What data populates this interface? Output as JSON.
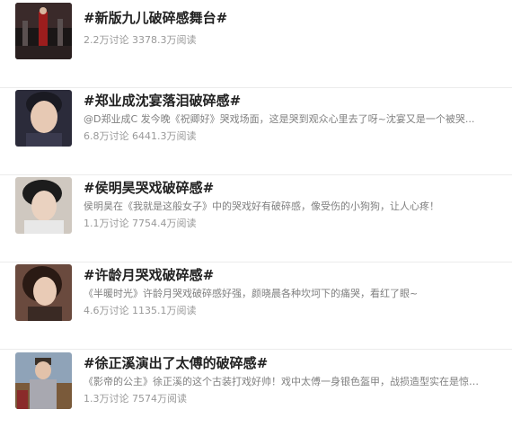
{
  "topics": [
    {
      "title": "#新版九儿破碎感舞台#",
      "description": "",
      "stats": "2.2万讨论 3378.3万阅读",
      "thumbnail_icon": "stage-performance-image"
    },
    {
      "title": "#郑业成沈宴落泪破碎感#",
      "description": "@D郑业成C 发今晚《祝卿好》哭戏场面，这是哭到观众心里去了呀~沈宴又是一个被哭...",
      "stats": "6.8万讨论 6441.3万阅读",
      "thumbnail_icon": "actor-portrait-image"
    },
    {
      "title": "#侯明昊哭戏破碎感#",
      "description": "侯明昊在《我就是这般女子》中的哭戏好有破碎感，像受伤的小狗狗，让人心疼！",
      "stats": "1.1万讨论 7754.4万阅读",
      "thumbnail_icon": "actor-portrait-image"
    },
    {
      "title": "#许龄月哭戏破碎感#",
      "description": "《半暖时光》许龄月哭戏破碎感好强，颜晓晨各种坎坷下的痛哭，看红了眼~",
      "stats": "4.6万讨论 1135.1万阅读",
      "thumbnail_icon": "actress-portrait-image"
    },
    {
      "title": "#徐正溪演出了太傅的破碎感#",
      "description": "《影帝的公主》徐正溪的这个古装打戏好帅！戏中太傅一身银色盔甲，战损造型实在是惊艳...",
      "stats": "1.3万讨论 7574万阅读",
      "thumbnail_icon": "armored-actor-image"
    }
  ],
  "colors": {
    "title": "#222222",
    "description": "#808080",
    "stats": "#999999",
    "divider": "#ececec"
  }
}
